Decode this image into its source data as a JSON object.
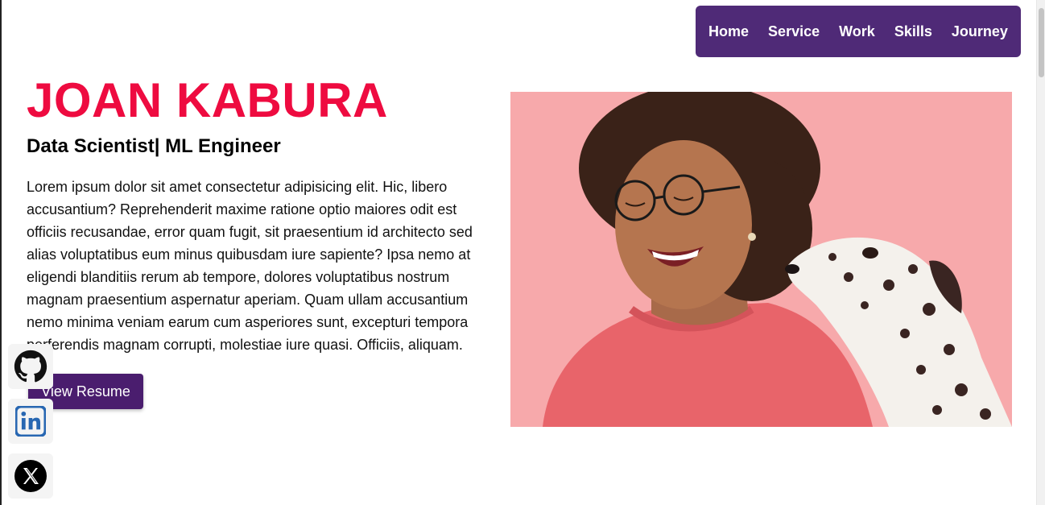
{
  "nav": {
    "items": [
      {
        "label": "Home"
      },
      {
        "label": "Service"
      },
      {
        "label": "Work"
      },
      {
        "label": "Skills"
      },
      {
        "label": "Journey"
      }
    ]
  },
  "hero": {
    "name": "JOAN KABURA",
    "title": "Data Scientist| ML Engineer",
    "description": "Lorem ipsum dolor sit amet consectetur adipisicing elit. Hic, libero accusantium? Reprehenderit maxime ratione optio maiores odit est officiis recusandae, error quam fugit, sit praesentium id architecto sed alias voluptatibus eum minus quibusdam iure sapiente? Ipsa nemo at eligendi blanditiis rerum ab tempore, dolores voluptatibus nostrum magnam praesentium aspernatur aperiam. Quam ullam accusantium nemo minima veniam earum cum asperiores sunt, excepturi tempora perferendis magnam corrupti, molestiae iure quasi. Officiis, aliquam.",
    "resume_button": "View Resume"
  },
  "social": [
    {
      "icon": "github-icon"
    },
    {
      "icon": "linkedin-icon"
    },
    {
      "icon": "x-twitter-icon"
    }
  ],
  "colors": {
    "nav_bg": "#4f2a77",
    "name_accent": "#ee0b40",
    "button_bg": "#4a1d6e",
    "photo_bg": "#f7a9ab"
  }
}
